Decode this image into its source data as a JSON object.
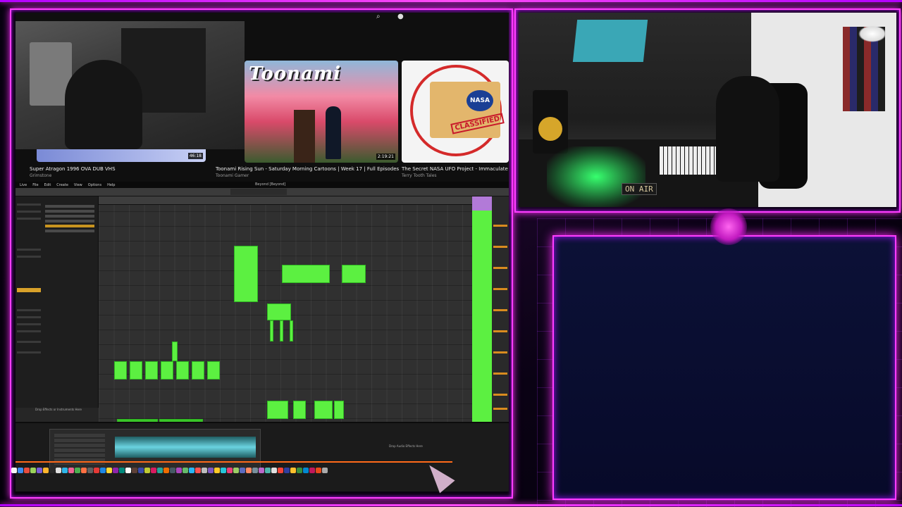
{
  "youtube": {
    "videos": [
      {
        "title": "Super Atragon 1996 OVA DUB VHS",
        "channel": "Grimstone",
        "duration": "46:18"
      },
      {
        "title": "Toonami Rising Sun - Saturday Morning Cartoons | Week 17 | Full Episodes",
        "channel": "Toonami Gamer",
        "duration": "2:19:21",
        "thumb_logo": "Toonami"
      },
      {
        "title": "The Secret NASA UFO Project - Immaculate Con",
        "channel": "Terry Tooth Tales",
        "thumb_badge": "NASA",
        "thumb_stamp": "CLASSIFIED"
      }
    ]
  },
  "daw": {
    "menu": [
      "Live",
      "File",
      "Edit",
      "Create",
      "View",
      "Options",
      "Help"
    ],
    "title": "Beyond [Beyond]",
    "drop_audio": "Drop Audio Effects Here",
    "drop_midi": "Drop Effects or Instruments Here"
  },
  "studio": {
    "on_air_sign": "ON AIR"
  },
  "colors": {
    "neon": "#ff3dff",
    "clip_green": "#5cf041",
    "panel_navy": "#0c1137"
  }
}
